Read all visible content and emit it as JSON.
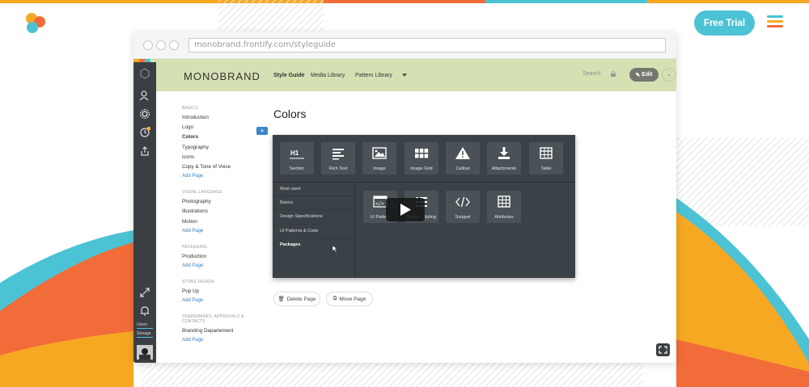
{
  "page": {
    "cta_label": "Free Trial",
    "colors": {
      "cta": "#4cc3d4",
      "orange": "#f26c3a",
      "yellow": "#f7a823",
      "teal": "#4cc3d4",
      "green": "#d5e1b3",
      "dark": "#3b4247"
    }
  },
  "browser": {
    "url": "monobrand.frontify.com/styleguide"
  },
  "header": {
    "brand": "MONOBRAND",
    "nav": [
      "Style Guide",
      "Media Library",
      "Pattern Library"
    ],
    "search_label": "Search",
    "edit_label": "Edit"
  },
  "app_sidebar": {
    "users_label": "Users",
    "storage_label": "Storage"
  },
  "toc": {
    "basics": {
      "heading": "BASICS",
      "items": [
        "Introduction",
        "Logo",
        "Colors",
        "Typography",
        "Icons",
        "Copy & Tone of Voice"
      ],
      "add": "Add Page"
    },
    "visual": {
      "heading": "VISUAL LANGUAGE",
      "items": [
        "Photography",
        "Illustrations",
        "Motion"
      ],
      "add": "Add Page"
    },
    "packaging": {
      "heading": "PACKAGING",
      "items": [
        "Production"
      ],
      "add": "Add Page"
    },
    "store": {
      "heading": "STORE DESIGN",
      "items": [
        "Pop Up"
      ],
      "add": "Add Page"
    },
    "trademarks": {
      "heading": "TRADEMARKS, APPROVALS & CONTACTS",
      "items": [
        "Branding Departement"
      ],
      "add": "Add Page"
    }
  },
  "content": {
    "title": "Colors",
    "add_symbol": "+",
    "delete_label": "Delete Page",
    "move_label": "Move Page"
  },
  "block_panel": {
    "top_blocks": [
      "Section",
      "Rich Text",
      "Image",
      "Image Grid",
      "Callout",
      "Attachments",
      "Table"
    ],
    "categories": [
      "Most used",
      "Basics",
      "Design Specifications",
      "UI Patterns & Code",
      "Packages"
    ],
    "active_category": "Packages",
    "sub_blocks": [
      "UI Pattern",
      "Pattern Styling",
      "Snippet",
      "Attributes"
    ]
  }
}
